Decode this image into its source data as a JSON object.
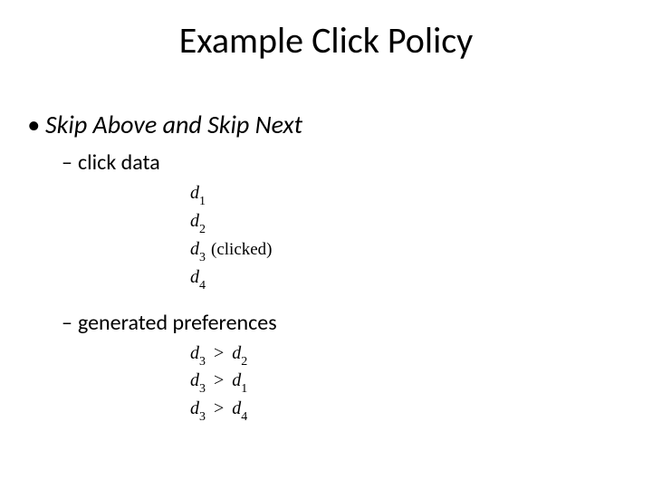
{
  "title": "Example Click Policy",
  "bullets": {
    "l1": "Skip Above and Skip Next",
    "l2a": "click data",
    "l2b": "generated preferences"
  },
  "click_data": {
    "d1": {
      "var": "d",
      "sub": "1"
    },
    "d2": {
      "var": "d",
      "sub": "2"
    },
    "d3": {
      "var": "d",
      "sub": "3",
      "note": "(clicked)"
    },
    "d4": {
      "var": "d",
      "sub": "4"
    }
  },
  "prefs": {
    "p1": {
      "lv": "d",
      "ls": "3",
      "op": ">",
      "rv": "d",
      "rs": "2"
    },
    "p2": {
      "lv": "d",
      "ls": "3",
      "op": ">",
      "rv": "d",
      "rs": "1"
    },
    "p3": {
      "lv": "d",
      "ls": "3",
      "op": ">",
      "rv": "d",
      "rs": "4"
    }
  }
}
